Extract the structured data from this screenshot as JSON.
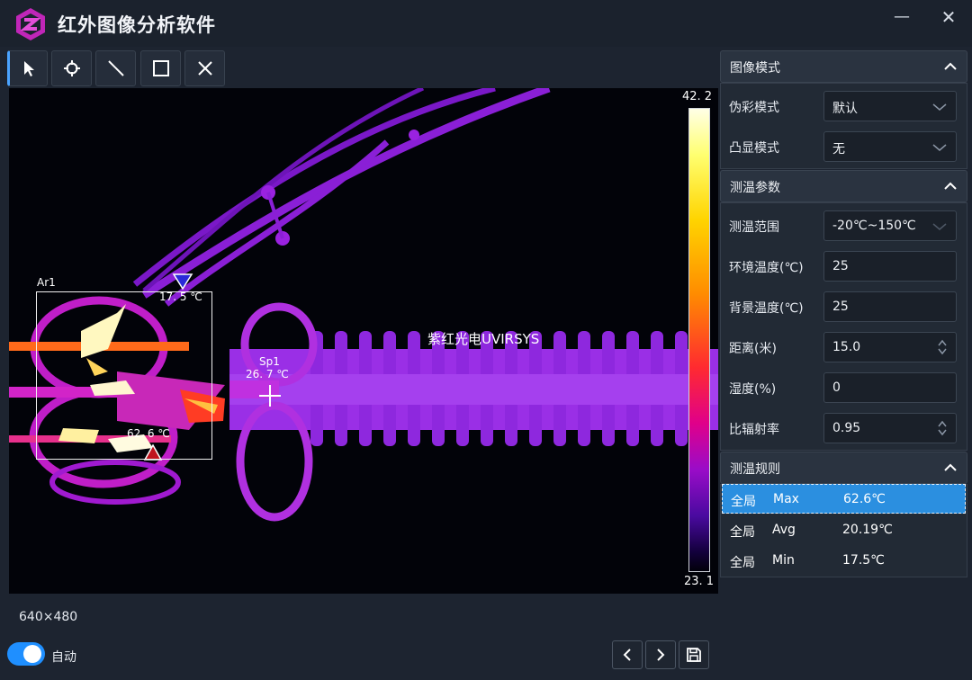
{
  "app": {
    "title": "红外图像分析软件"
  },
  "window_controls": {
    "minimize": "—",
    "close": "✕"
  },
  "toolbar": {
    "tools": [
      {
        "name": "select",
        "icon": "cursor-arrow-icon"
      },
      {
        "name": "point",
        "icon": "crosshair-target-icon"
      },
      {
        "name": "line",
        "icon": "line-tool-icon"
      },
      {
        "name": "rectangle",
        "icon": "rectangle-tool-icon"
      },
      {
        "name": "clear",
        "icon": "x-close-icon"
      }
    ]
  },
  "viewer": {
    "scale_max": "42. 2",
    "scale_min": "23. 1",
    "watermark": "紫红光电UVIRSYS",
    "area_label": "Ar1",
    "area_min_temp": "17. 5 ℃",
    "area_max_temp": "62. 6 ℃",
    "spot_label": "Sp1",
    "spot_temp": "26. 7 ℃",
    "palette": "ironbow",
    "palette_colors": {
      "hot": "#ffffe6",
      "mid": "#ff2a30",
      "cool": "#9a0cc8",
      "cold": "#02000a"
    }
  },
  "status": {
    "resolution": "640×480",
    "auto_label": "自动",
    "auto_on": true
  },
  "panel": {
    "image_mode": {
      "title": "图像模式",
      "pseudo_color_label": "伪彩模式",
      "pseudo_color_value": "默认",
      "highlight_label": "凸显模式",
      "highlight_value": "无"
    },
    "measure": {
      "title": "测温参数",
      "range_label": "测温范围",
      "range_value": "-20℃~150℃",
      "ambient_label": "环境温度(℃)",
      "ambient_value": "25",
      "background_label": "背景温度(℃)",
      "background_value": "25",
      "distance_label": "距离(米)",
      "distance_value": "15.0",
      "humidity_label": "湿度(%)",
      "humidity_value": "0",
      "emissivity_label": "比辐射率",
      "emissivity_value": "0.95"
    },
    "rules": {
      "title": "测温规则",
      "rows": [
        {
          "scope": "全局",
          "kind": "Max",
          "value": "62.6℃"
        },
        {
          "scope": "全局",
          "kind": "Avg",
          "value": "20.19℃"
        },
        {
          "scope": "全局",
          "kind": "Min",
          "value": "17.5℃"
        }
      ]
    }
  },
  "colors": {
    "accent": "#1f8fff",
    "selected_row": "#2b8fe0",
    "background": "#1d2430"
  }
}
